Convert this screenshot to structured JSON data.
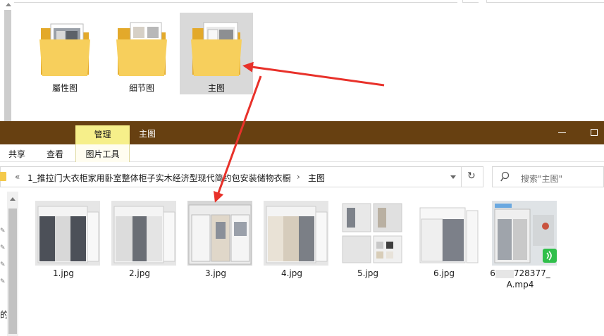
{
  "top_window": {
    "folders": [
      {
        "name": "屬性图",
        "selected": false
      },
      {
        "name": "细节图",
        "selected": false
      },
      {
        "name": "主图",
        "selected": true
      }
    ]
  },
  "explorer": {
    "ribbon_context_tab": "管理",
    "window_title": "主图",
    "ribbon_tabs": [
      "共享",
      "查看"
    ],
    "ribbon_tools_tab": "图片工具",
    "address": {
      "back_chevron": "«",
      "path": [
        "1_推拉门大衣柜家用卧室整体柜子实木经济型现代简约包安装储物衣橱",
        "主图"
      ],
      "separator": "›",
      "refresh_glyph": "↻"
    },
    "search": {
      "placeholder": "搜索\"主图\""
    },
    "nav_truncated_label": "的]",
    "files": [
      {
        "name": "1.jpg",
        "kind": "image"
      },
      {
        "name": "2.jpg",
        "kind": "image"
      },
      {
        "name": "3.jpg",
        "kind": "image"
      },
      {
        "name": "4.jpg",
        "kind": "image"
      },
      {
        "name": "5.jpg",
        "kind": "image"
      },
      {
        "name": "6.jpg",
        "kind": "image"
      },
      {
        "name": "6",
        "name_tail": "728377_",
        "name_line2": "A.mp4",
        "kind": "video"
      }
    ]
  },
  "colors": {
    "titlebar": "#674011",
    "context_tab": "#f6ef8a",
    "selection": "#d9d9d9",
    "folder": "#f4c94b",
    "annotation_arrow": "#e8312a"
  }
}
